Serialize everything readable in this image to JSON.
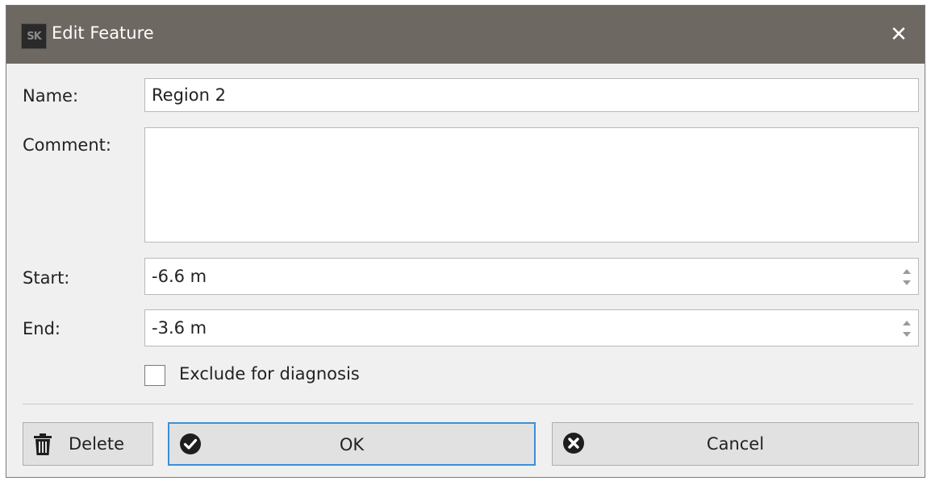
{
  "window": {
    "title": "Edit Feature",
    "close_glyph": "✕",
    "app_icon": "SK"
  },
  "form": {
    "name_label": "Name:",
    "name_value": "Region 2",
    "comment_label": "Comment:",
    "comment_value": "",
    "start_label": "Start:",
    "start_value": "-6.6 m",
    "end_label": "End:",
    "end_value": "-3.6 m",
    "exclude_label": "Exclude for diagnosis",
    "exclude_checked": false
  },
  "buttons": {
    "delete_label": "Delete",
    "ok_label": "OK",
    "cancel_label": "Cancel"
  },
  "icons": {
    "app": "app-logo-icon",
    "close": "close-icon",
    "delete": "trash-icon",
    "ok": "checkmark-circle-icon",
    "cancel": "x-circle-icon"
  },
  "colors": {
    "titlebar": "#6e6862",
    "ok_focus_border": "#3c8fd8"
  }
}
